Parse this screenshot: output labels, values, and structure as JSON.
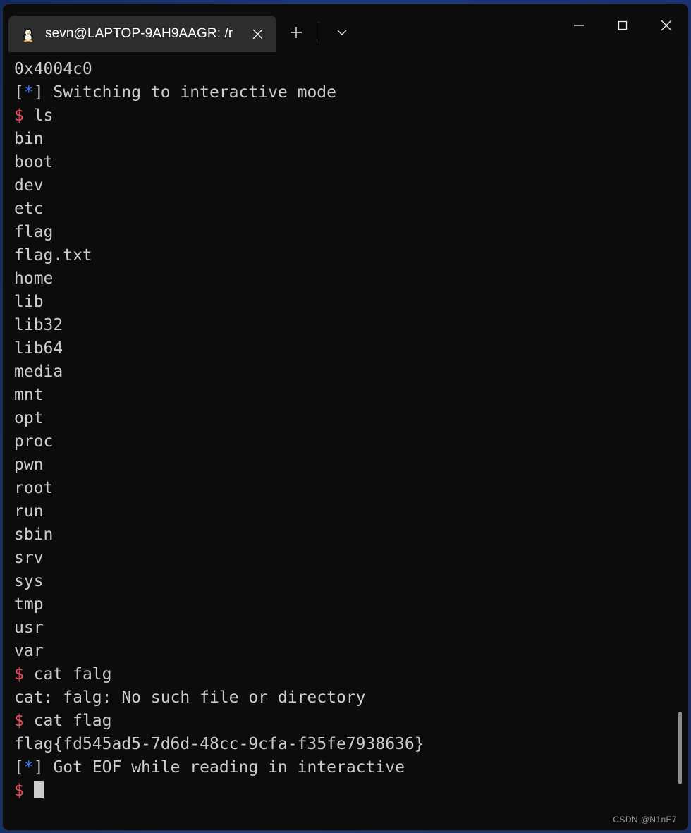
{
  "window": {
    "controls": {
      "minimize_label": "Minimize",
      "maximize_label": "Maximize",
      "close_label": "Close"
    }
  },
  "tabbar": {
    "tabs": [
      {
        "icon": "linux-penguin-icon",
        "title": "sevn@LAPTOP-9AH9AAGR: /r",
        "close_label": "Close tab"
      }
    ],
    "new_tab_label": "+",
    "dropdown_label": "Open new tab dropdown"
  },
  "terminal": {
    "background": "#0c0c0c",
    "foreground": "#cccccc",
    "prompt_color": "#e74856",
    "status_color": "#3b78ff",
    "prompt_symbol": "$",
    "lines": [
      {
        "type": "plain",
        "text": "0x4004c0"
      },
      {
        "type": "status",
        "bracket_open": "[",
        "marker": "*",
        "bracket_close": "]",
        "text": " Switching to interactive mode"
      },
      {
        "type": "prompt",
        "command": " ls"
      },
      {
        "type": "plain",
        "text": "bin"
      },
      {
        "type": "plain",
        "text": "boot"
      },
      {
        "type": "plain",
        "text": "dev"
      },
      {
        "type": "plain",
        "text": "etc"
      },
      {
        "type": "plain",
        "text": "flag"
      },
      {
        "type": "plain",
        "text": "flag.txt"
      },
      {
        "type": "plain",
        "text": "home"
      },
      {
        "type": "plain",
        "text": "lib"
      },
      {
        "type": "plain",
        "text": "lib32"
      },
      {
        "type": "plain",
        "text": "lib64"
      },
      {
        "type": "plain",
        "text": "media"
      },
      {
        "type": "plain",
        "text": "mnt"
      },
      {
        "type": "plain",
        "text": "opt"
      },
      {
        "type": "plain",
        "text": "proc"
      },
      {
        "type": "plain",
        "text": "pwn"
      },
      {
        "type": "plain",
        "text": "root"
      },
      {
        "type": "plain",
        "text": "run"
      },
      {
        "type": "plain",
        "text": "sbin"
      },
      {
        "type": "plain",
        "text": "srv"
      },
      {
        "type": "plain",
        "text": "sys"
      },
      {
        "type": "plain",
        "text": "tmp"
      },
      {
        "type": "plain",
        "text": "usr"
      },
      {
        "type": "plain",
        "text": "var"
      },
      {
        "type": "prompt",
        "command": " cat falg"
      },
      {
        "type": "plain",
        "text": "cat: falg: No such file or directory"
      },
      {
        "type": "prompt",
        "command": " cat flag"
      },
      {
        "type": "plain",
        "text": "flag{fd545ad5-7d6d-48cc-9cfa-f35fe7938636}"
      },
      {
        "type": "status",
        "bracket_open": "[",
        "marker": "*",
        "bracket_close": "]",
        "text": " Got EOF while reading in interactive"
      },
      {
        "type": "prompt",
        "command": " ",
        "cursor": true
      }
    ]
  },
  "watermark": {
    "text": "CSDN @N1nE7"
  }
}
